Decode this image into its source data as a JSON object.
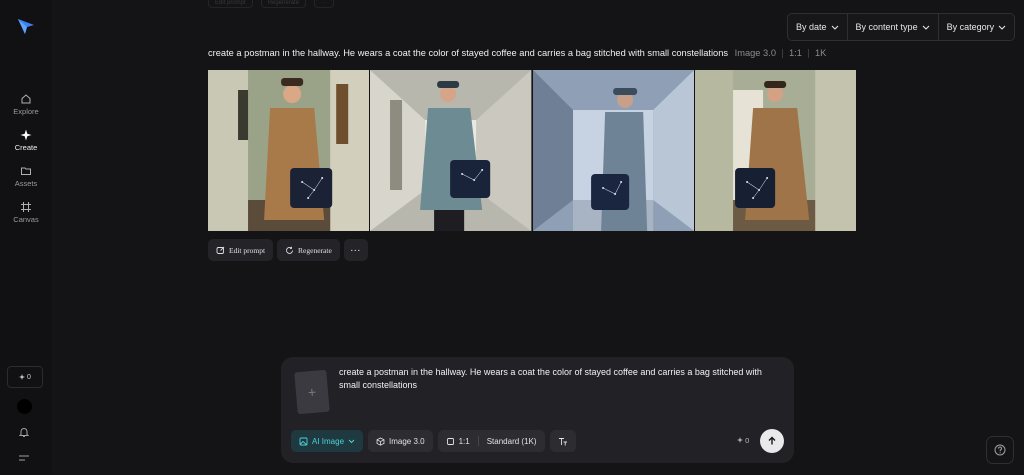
{
  "sidebar": {
    "items": [
      {
        "label": "Explore",
        "icon": "home-icon"
      },
      {
        "label": "Create",
        "icon": "sparkle-icon"
      },
      {
        "label": "Assets",
        "icon": "folder-icon"
      },
      {
        "label": "Canvas",
        "icon": "canvas-icon"
      }
    ],
    "credits": "0"
  },
  "top_hidden_actions": {
    "edit": "Edit prompt",
    "regen": "Regenerate"
  },
  "filters": {
    "date": "By date",
    "content": "By content type",
    "category": "By category"
  },
  "result": {
    "prompt": "create a postman in the hallway. He wears a coat the color of stayed coffee and carries a bag stitched with small constellations",
    "model": "Image 3.0",
    "ratio": "1:1",
    "resolution": "1K"
  },
  "actions": {
    "edit": "Edit prompt",
    "regenerate": "Regenerate",
    "more": "···"
  },
  "composer": {
    "text": "create a postman in the hallway. He wears a coat the color of stayed coffee and carries a bag stitched with small constellations",
    "mode": "AI Image",
    "model": "Image 3.0",
    "ratio": "1:1",
    "quality": "Standard (1K)",
    "cost": "0"
  },
  "colors": {
    "accent": "#4fd1d9",
    "background": "#141417"
  }
}
